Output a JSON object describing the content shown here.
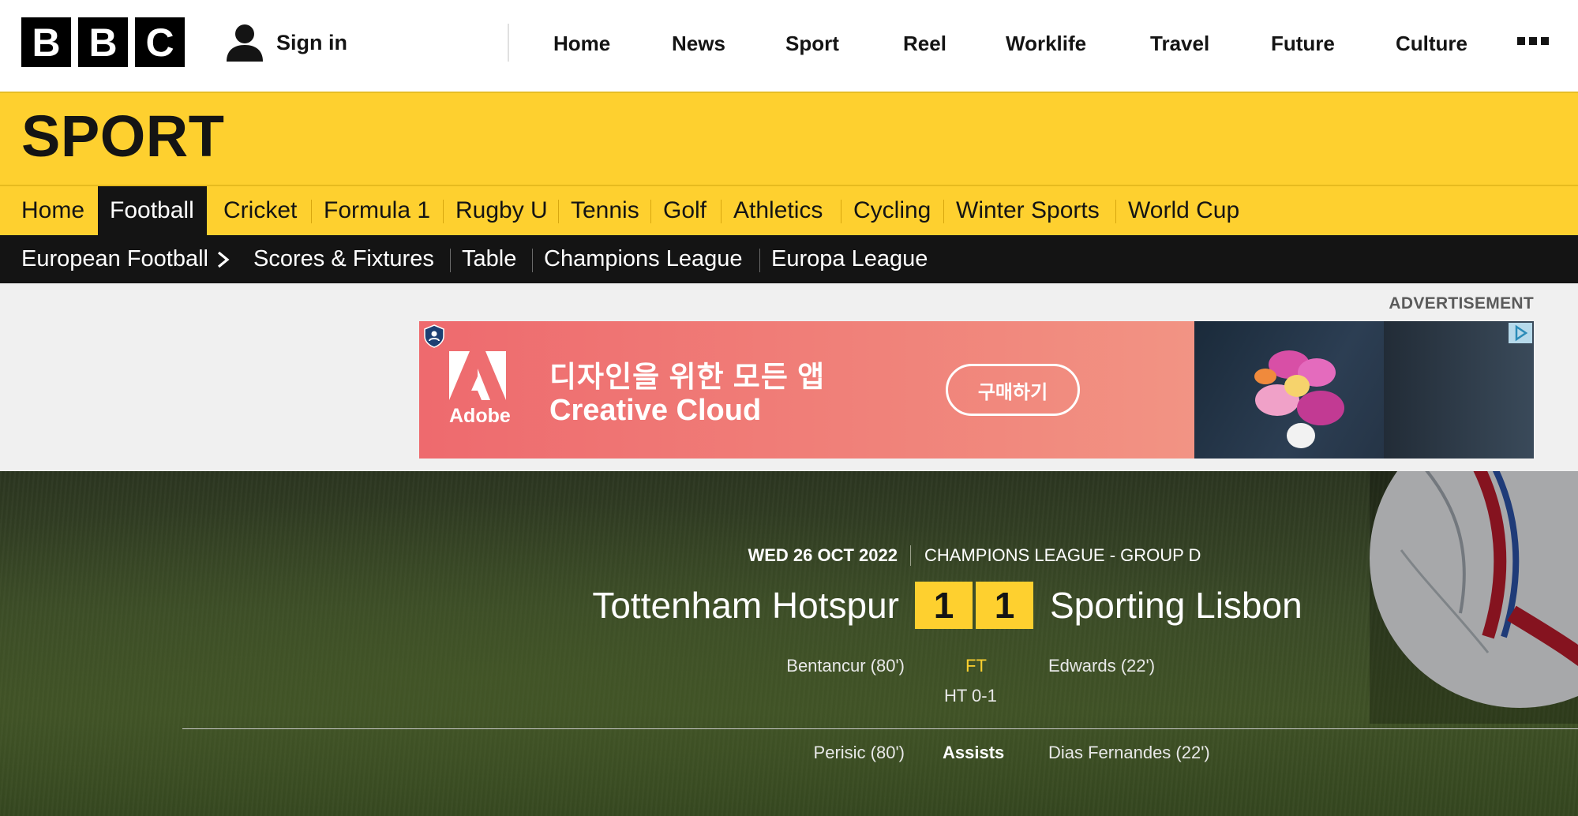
{
  "brand": {
    "letters": [
      "B",
      "B",
      "C"
    ]
  },
  "account": {
    "sign_in_label": "Sign in",
    "icon": "user-icon"
  },
  "top_nav": {
    "items": [
      {
        "label": "Home"
      },
      {
        "label": "News"
      },
      {
        "label": "Sport"
      },
      {
        "label": "Reel"
      },
      {
        "label": "Worklife"
      },
      {
        "label": "Travel"
      },
      {
        "label": "Future"
      },
      {
        "label": "Culture"
      }
    ],
    "more_icon": "more-dots-icon"
  },
  "section": {
    "title": "SPORT",
    "accent_color": "#fed02f"
  },
  "sport_nav": {
    "items": [
      {
        "label": "Home"
      },
      {
        "label": "Football",
        "active": true
      },
      {
        "label": "Cricket"
      },
      {
        "label": "Formula 1"
      },
      {
        "label": "Rugby U"
      },
      {
        "label": "Tennis"
      },
      {
        "label": "Golf"
      },
      {
        "label": "Athletics"
      },
      {
        "label": "Cycling"
      },
      {
        "label": "Winter Sports"
      },
      {
        "label": "World Cup"
      }
    ]
  },
  "sub_nav": {
    "items": [
      {
        "label": "European Football"
      },
      {
        "label": "Scores & Fixtures"
      },
      {
        "label": "Table"
      },
      {
        "label": "Champions League"
      },
      {
        "label": "Europa League"
      }
    ]
  },
  "advertisement": {
    "label": "ADVERTISEMENT",
    "brand": "Adobe",
    "headline_ko": "디자인을 위한 모든 앱",
    "headline_en": "Creative Cloud",
    "cta": "구매하기"
  },
  "match": {
    "date": "WED 26 OCT 2022",
    "competition": "CHAMPIONS LEAGUE - GROUP D",
    "home_team": "Tottenham Hotspur",
    "away_team": "Sporting Lisbon",
    "home_score": "1",
    "away_score": "1",
    "status": "FT",
    "half_time": "HT 0-1",
    "home_scorers": "Bentancur (80')",
    "away_scorers": "Edwards (22')",
    "assists_label": "Assists",
    "home_assists": "Perisic (80')",
    "away_assists": "Dias Fernandes (22')"
  }
}
